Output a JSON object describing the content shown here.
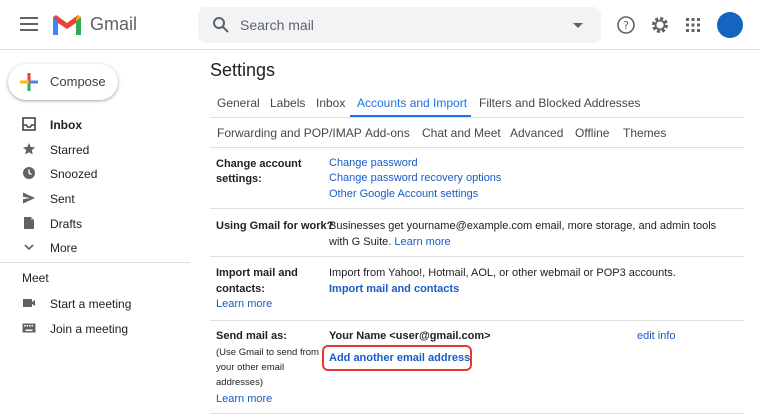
{
  "header": {
    "app_name": "Gmail",
    "search_placeholder": "Search mail"
  },
  "sidebar": {
    "compose_label": "Compose",
    "items": [
      {
        "label": "Inbox",
        "icon": "inbox-icon"
      },
      {
        "label": "Starred",
        "icon": "star-icon"
      },
      {
        "label": "Snoozed",
        "icon": "clock-icon"
      },
      {
        "label": "Sent",
        "icon": "send-icon"
      },
      {
        "label": "Drafts",
        "icon": "draft-icon"
      },
      {
        "label": "More",
        "icon": "chevron-down-icon"
      }
    ],
    "meet": {
      "title": "Meet",
      "items": [
        {
          "label": "Start a meeting",
          "icon": "video-icon"
        },
        {
          "label": "Join a meeting",
          "icon": "keyboard-icon"
        }
      ]
    }
  },
  "settings": {
    "title": "Settings",
    "tabs_row1": [
      "General",
      "Labels",
      "Inbox",
      "Accounts and Import",
      "Filters and Blocked Addresses"
    ],
    "tabs_row2": [
      "Forwarding and POP/IMAP",
      "Add-ons",
      "Chat and Meet",
      "Advanced",
      "Offline",
      "Themes"
    ],
    "active_tab": "Accounts and Import",
    "sections": {
      "change_account": {
        "label_line1": "Change account",
        "label_line2": "settings:",
        "links": [
          "Change password",
          "Change password recovery options",
          "Other Google Account settings"
        ]
      },
      "work": {
        "label": "Using Gmail for work?",
        "text_line1": "Businesses get yourname@example.com email, more storage, and admin tools",
        "text_line2": "with G Suite.",
        "learn_more": "Learn more"
      },
      "import": {
        "label_line1": "Import mail and",
        "label_line2": "contacts:",
        "learn_more": "Learn more",
        "text": "Import from Yahoo!, Hotmail, AOL, or other webmail or POP3 accounts.",
        "action": "Import mail and contacts"
      },
      "send_as": {
        "label": "Send mail as:",
        "sub_line1": "(Use Gmail to send from",
        "sub_line2": "your other email",
        "sub_line3": "addresses)",
        "learn_more": "Learn more",
        "identity": "Your Name <user@gmail.com>",
        "edit_info": "edit info",
        "add_address": "Add another email address"
      }
    }
  },
  "colors": {
    "accent": "#1a73e8",
    "link": "#1a5bc4",
    "highlight": "#e53935",
    "avatar": "#1565c0"
  }
}
